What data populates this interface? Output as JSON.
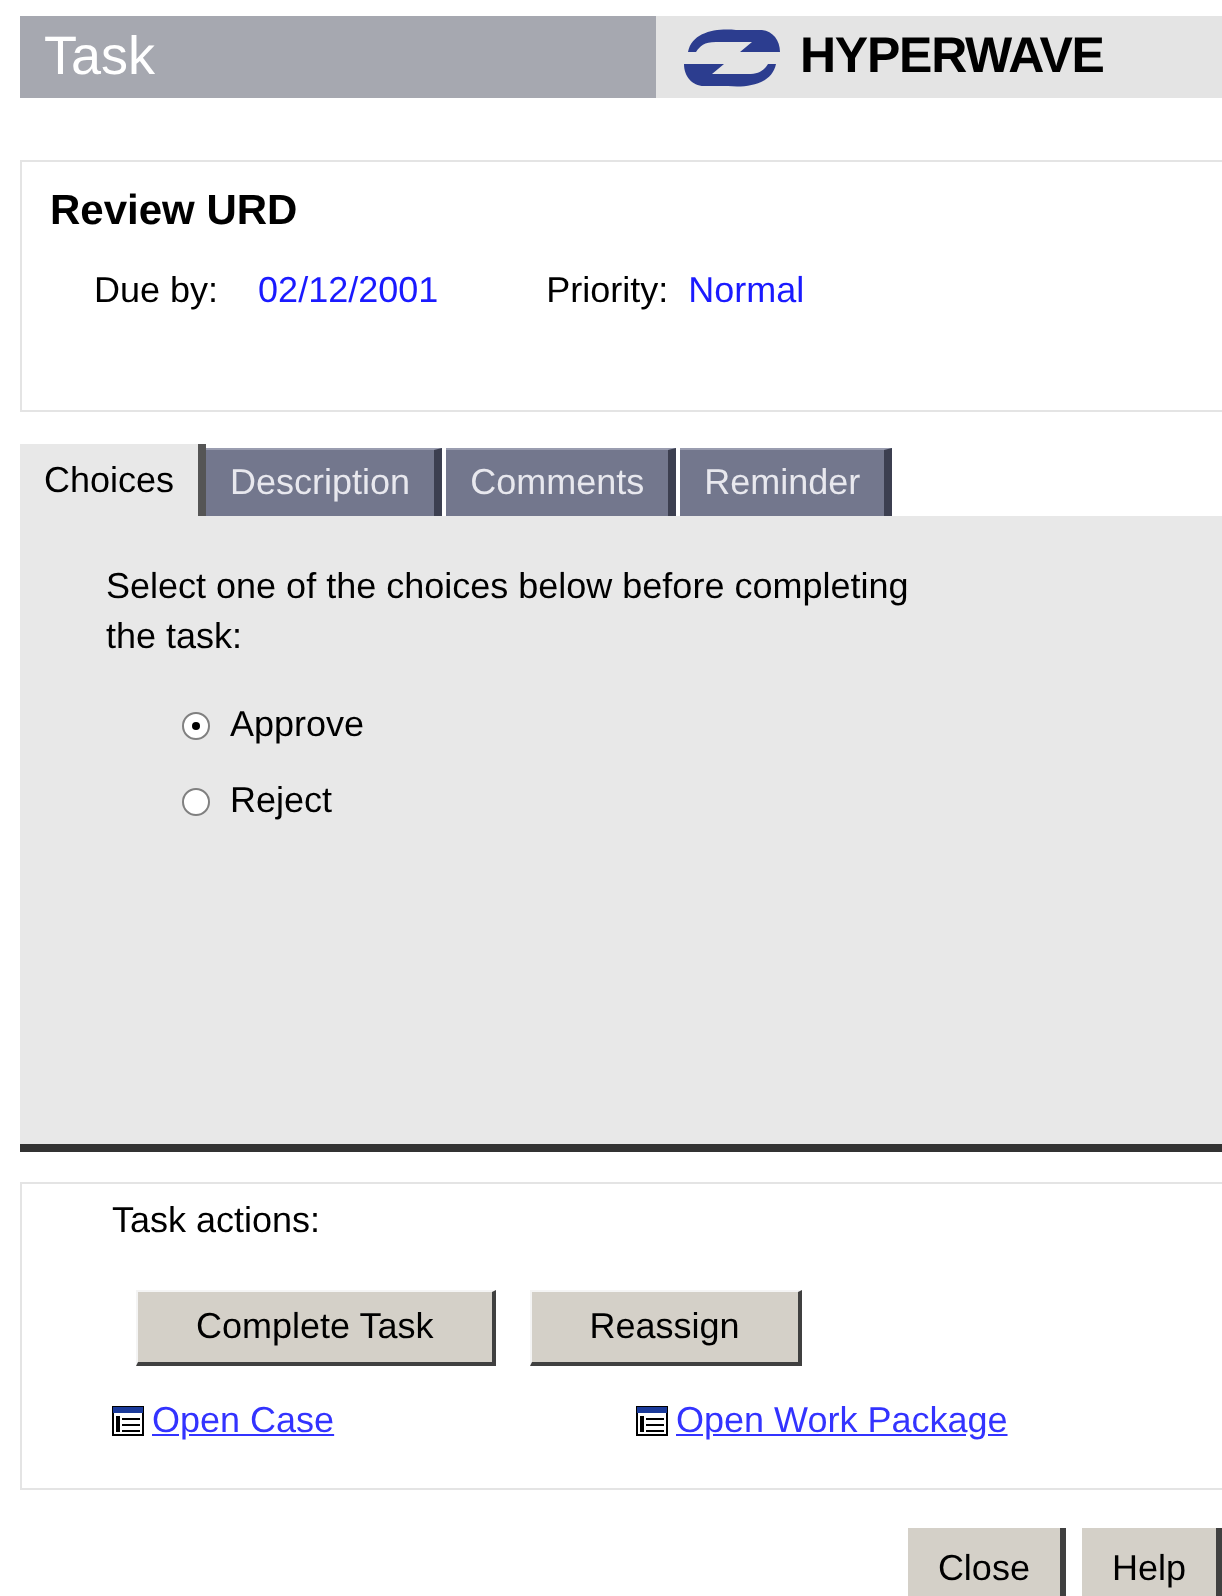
{
  "header": {
    "title": "Task",
    "logo": "HYPERWAVE"
  },
  "task": {
    "name": "Review URD",
    "due_label": "Due by:",
    "due_value": "02/12/2001",
    "priority_label": "Priority:",
    "priority_value": "Normal"
  },
  "tabs": [
    {
      "label": "Choices",
      "selected": true
    },
    {
      "label": "Description",
      "selected": false
    },
    {
      "label": "Comments",
      "selected": false
    },
    {
      "label": "Reminder",
      "selected": false
    }
  ],
  "choices": {
    "prompt": "Select one of the choices below before completing the task:",
    "options": [
      {
        "label": "Approve",
        "selected": true
      },
      {
        "label": "Reject",
        "selected": false
      }
    ]
  },
  "actions": {
    "title": "Task actions:",
    "buttons": [
      "Complete Task",
      "Reassign"
    ],
    "links": [
      "Open Case",
      "Open Work Package"
    ]
  },
  "footer_buttons": [
    "Close",
    "Help"
  ]
}
